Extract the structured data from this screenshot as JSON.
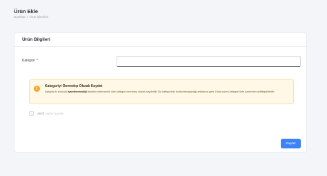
{
  "page": {
    "title": "Ürün Ekle",
    "breadcrumb": [
      "Dashbar",
      "Ürün İşlemleri"
    ]
  },
  "card": {
    "title": "Ürün Bilgileri"
  },
  "form": {
    "category_label": "Kategori",
    "required_mark": "*",
    "category_value": ""
  },
  "alert": {
    "icon": "warning-icon",
    "icon_glyph": "!",
    "title": "Kategoriyi Devredışı Olarak Kaydet",
    "text_before": "Aşağıda ki kutucuk ",
    "text_bold": "işaretlenmediği",
    "text_after": " takdirde eklemecek olan kategori devredışı olarak kaydedilir. Bu kategorinin kullanılamayacağı anlatama gidir. Daha sonra kategori liste üzerinden aktifleştirilebilir."
  },
  "checkbox": {
    "checked": false,
    "label_bold": "AKtif",
    "label_rest": " olarak işaretle"
  },
  "actions": {
    "save_label": "Kaydet"
  },
  "colors": {
    "accent": "#3d82f6",
    "warning_bg": "#fff8e6",
    "warning_icon": "#f5a623"
  }
}
